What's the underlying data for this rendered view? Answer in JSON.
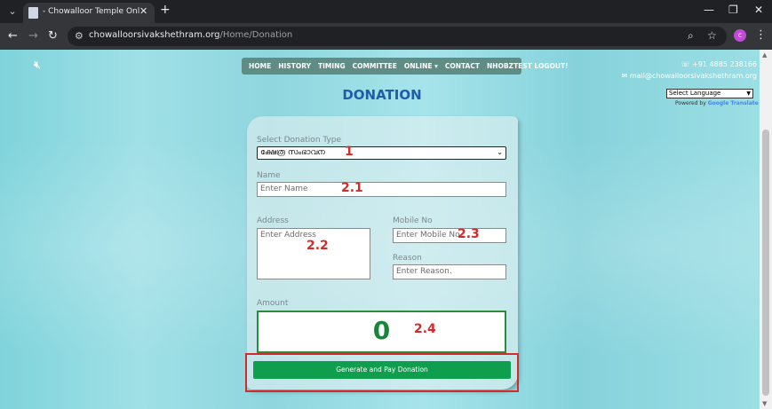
{
  "browser": {
    "tab_title": "- Chowalloor Temple Online Of",
    "url_host": "chowalloorsivakshethram.org",
    "url_path": "/Home/Donation",
    "avatar_letter": "c"
  },
  "site": {
    "nav": [
      "HOME",
      "HISTORY",
      "TIMING",
      "COMMITTEE",
      "ONLINE ▾",
      "CONTACT",
      "NHOBZTEST LOGOUT!"
    ],
    "phone": "☏ +91 4885 238166",
    "email": "✉ mail@chowalloorsivakshethram.org",
    "language_select": "Select Language",
    "powered_by": "Powered by",
    "powered_brand": "Google Translate"
  },
  "page": {
    "title": "DONATION"
  },
  "form": {
    "donation_type_label": "Select Donation Type",
    "donation_type_value": "ക്ഷേത്ര സംഭാവന",
    "name_label": "Name",
    "name_placeholder": "Enter Name",
    "address_label": "Address",
    "address_placeholder": "Enter Address",
    "mobile_label": "Mobile No",
    "mobile_placeholder": "Enter Mobile No.",
    "reason_label": "Reason",
    "reason_placeholder": "Enter Reason.",
    "amount_label": "Amount",
    "amount_value": "0",
    "submit_label": "Generate and Pay Donation"
  },
  "annotations": {
    "a1": "1",
    "a21": "2.1",
    "a22": "2.2",
    "a23": "2.3",
    "a24": "2.4"
  },
  "colors": {
    "highlight": "#d42a2a",
    "button": "#0f9e4e",
    "title": "#1f5da8"
  }
}
